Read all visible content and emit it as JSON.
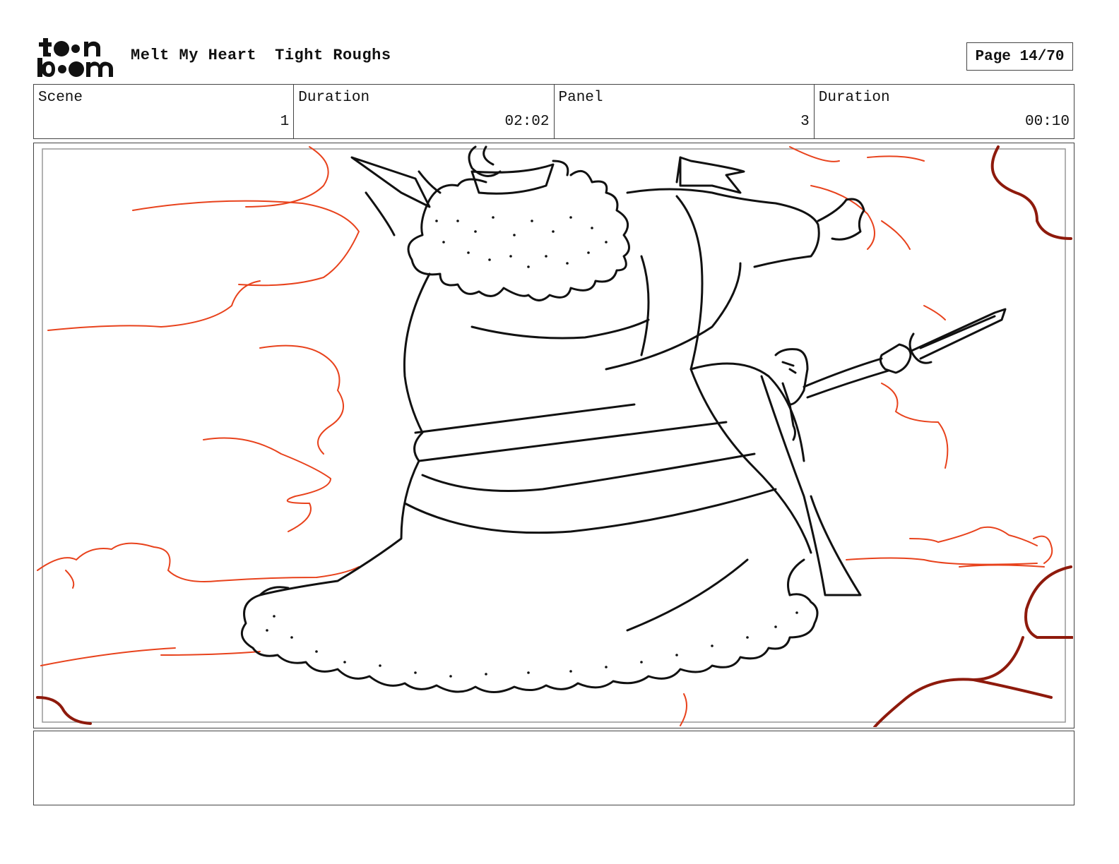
{
  "header": {
    "logo_top": "toon",
    "logo_bottom": "boom",
    "project": "Melt My Heart",
    "stage": "Tight Roughs",
    "page_label": "Page 14/70"
  },
  "info": {
    "scene_label": "Scene",
    "scene_value": "1",
    "scene_duration_label": "Duration",
    "scene_duration_value": "02:02",
    "panel_label": "Panel",
    "panel_value": "3",
    "panel_duration_label": "Duration",
    "panel_duration_value": "00:10"
  },
  "colors": {
    "line": "#111111",
    "cloud": "#e8421c",
    "cloud_dark": "#8e1a0c"
  },
  "notes": {
    "text": ""
  }
}
